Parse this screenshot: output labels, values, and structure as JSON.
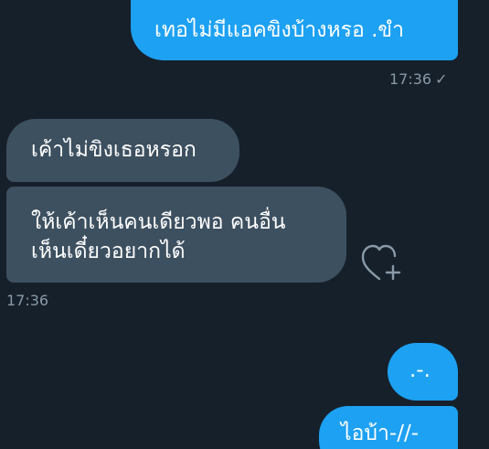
{
  "conversation": {
    "messages": [
      {
        "id": "m1",
        "direction": "sent",
        "text": "เทอไม่มีแอคขิงบ้างหรอ .ขำ"
      },
      {
        "id": "m2",
        "direction": "received",
        "text": "เค้าไม่ขิงเธอหรอก"
      },
      {
        "id": "m3",
        "direction": "received",
        "lines": [
          "ให้เค้าเห็นคนเดียวพอ คนอื่น",
          "เห็นเดี๋ยวอยากได้"
        ]
      },
      {
        "id": "m4",
        "direction": "sent",
        "text": ".-."
      },
      {
        "id": "m5",
        "direction": "sent",
        "text": "ไอบ้า-//-"
      }
    ],
    "sent_timestamp": "17:36",
    "sent_status_icon": "✓",
    "received_timestamp": "17:36",
    "reaction_icon": "heart-add-icon"
  },
  "colors": {
    "background": "#16202b",
    "sent_bubble": "#1da1f2",
    "received_bubble": "#3d5060",
    "timestamp": "#8899a6"
  }
}
